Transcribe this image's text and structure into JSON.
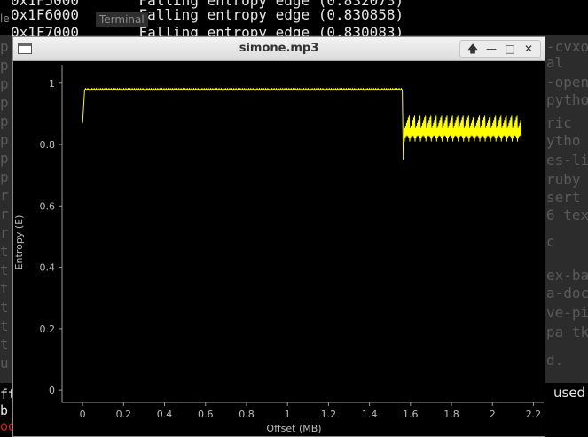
{
  "terminal": {
    "tab_label": "Terminal",
    "tab_left": "le",
    "top_lines": [
      "0x1F5000       Falling entropy edge (0.832073)",
      "0x1F6000       Falling entropy edge (0.830858)",
      "0x1F7000       Falling entropy edge (0.830083)"
    ],
    "left_chars": [
      "p",
      "p",
      "p",
      "p",
      "p",
      "p",
      "p",
      "p",
      "r",
      "r",
      "r",
      "t",
      "t",
      "t",
      "t",
      "t",
      "t",
      "u"
    ],
    "right_fragments": [
      "-cvxo",
      "al",
      "-open",
      "pytho",
      "ric",
      "ytho",
      "es-li",
      "ruby",
      "sert",
      "6 tex",
      "c",
      "ex-ba",
      "a-doc",
      "ve-pi",
      "pa tk",
      "d."
    ],
    "bottom_lines": [
      "ft",
      "b",
      "oo"
    ],
    "used_label": "used"
  },
  "window": {
    "title": "simone.mp3",
    "controls": [
      "🡅",
      "—",
      "□",
      "✕"
    ]
  },
  "chart_data": {
    "type": "line",
    "title": "",
    "xlabel": "Offset (MB)",
    "ylabel": "Entropy (E)",
    "xlim": [
      -0.1,
      2.25
    ],
    "ylim": [
      -0.04,
      1.06
    ],
    "xticks": [
      "0",
      "0.2",
      "0.4",
      "0.6",
      "0.8",
      "1",
      "1.2",
      "1.4",
      "1.6",
      "1.8",
      "2",
      "2.2"
    ],
    "xtick_values": [
      0,
      0.2,
      0.4,
      0.6,
      0.8,
      1,
      1.2,
      1.4,
      1.6,
      1.8,
      2,
      2.2
    ],
    "yticks": [
      "0",
      "0.2",
      "0.4",
      "0.6",
      "0.8",
      "1"
    ],
    "ytick_values": [
      0,
      0.2,
      0.4,
      0.6,
      0.8,
      1
    ],
    "color": "#ffff00",
    "series": [
      {
        "x": [
          0.0,
          0.01,
          0.1,
          0.2,
          0.3,
          0.4,
          0.5,
          0.6,
          0.7,
          0.8,
          0.9,
          1.0,
          1.1,
          1.2,
          1.3,
          1.4,
          1.5,
          1.56,
          1.565,
          1.57,
          1.6,
          1.7,
          1.8,
          1.9,
          2.0,
          2.1,
          2.14
        ],
        "y": [
          0.87,
          0.98,
          0.979,
          0.98,
          0.978,
          0.98,
          0.979,
          0.978,
          0.98,
          0.979,
          0.978,
          0.98,
          0.979,
          0.978,
          0.98,
          0.979,
          0.98,
          0.978,
          0.75,
          0.83,
          0.84,
          0.845,
          0.84,
          0.845,
          0.84,
          0.845,
          0.83
        ]
      }
    ],
    "noise_band": {
      "x_start": 1.57,
      "x_end": 2.14,
      "y_low": 0.81,
      "y_high": 0.875
    },
    "flat_noise": {
      "x_start": 0.01,
      "x_end": 1.56,
      "y_low": 0.975,
      "y_high": 0.985
    }
  }
}
